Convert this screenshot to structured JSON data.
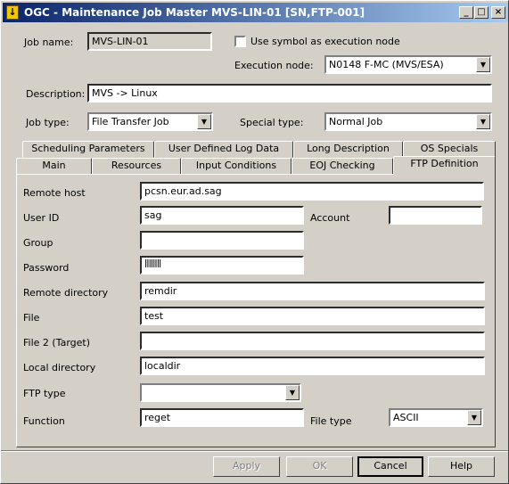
{
  "window": {
    "title": "OGC - Maintenance Job Master MVS-LIN-01 [SN,FTP-001]",
    "icon_glyph": "↓",
    "minimize_glyph": "_",
    "maximize_glyph": "□",
    "close_glyph": "×"
  },
  "header": {
    "job_name_label": "Job name:",
    "job_name_value": "MVS-LIN-01",
    "use_symbol_label": "Use symbol as execution node",
    "use_symbol_checked": false,
    "execution_node_label": "Execution node:",
    "execution_node_value": "N0148  F-MC (MVS/ESA)",
    "description_label": "Description:",
    "description_value": "MVS -> Linux",
    "job_type_label": "Job type:",
    "job_type_value": "File Transfer Job",
    "special_type_label": "Special type:",
    "special_type_value": "Normal Job"
  },
  "tabs_row1": [
    "Scheduling Parameters",
    "User Defined Log Data",
    "Long Description",
    "OS Specials"
  ],
  "tabs_row2": [
    "Main",
    "Resources",
    "Input Conditions",
    "EOJ Checking",
    "FTP Definition"
  ],
  "active_tab": "FTP Definition",
  "ftp": {
    "remote_host_label": "Remote host",
    "remote_host_value": "pcsn.eur.ad.sag",
    "user_id_label": "User ID",
    "user_id_value": "sag",
    "account_label": "Account",
    "account_value": "",
    "group_label": "Group",
    "group_value": "",
    "password_label": "Password",
    "password_value": "||||||||",
    "remote_directory_label": "Remote directory",
    "remote_directory_value": "remdir",
    "file_label": "File",
    "file_value": "test",
    "file2_label": "File 2 (Target)",
    "file2_value": "",
    "local_directory_label": "Local directory",
    "local_directory_value": "localdir",
    "ftp_type_label": "FTP type",
    "ftp_type_value": "",
    "function_label": "Function",
    "function_value": "reget",
    "file_type_label": "File type",
    "file_type_value": "ASCII"
  },
  "buttons": {
    "apply": "Apply",
    "ok": "OK",
    "cancel": "Cancel",
    "help": "Help"
  },
  "arrow_glyph": "▼"
}
